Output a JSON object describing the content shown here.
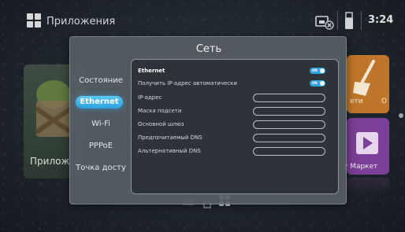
{
  "topbar": {
    "apps_title": "Приложения",
    "network_status_icon": "ethernet-disconnected-icon",
    "usb_icon": "usb-icon",
    "clock": "3:24"
  },
  "background": {
    "left_tile_label": "Прилож",
    "right_tile_1_label_a": "ети",
    "right_tile_1_label_b": "O",
    "right_tile_2_label": "у Маркет"
  },
  "dialog": {
    "title": "Сеть",
    "nav": [
      {
        "label": "Состояние",
        "active": false
      },
      {
        "label": "Ethernet",
        "active": true
      },
      {
        "label": "Wi-Fi",
        "active": false
      },
      {
        "label": "PPPoE",
        "active": false
      },
      {
        "label": "Точка досту",
        "active": false
      }
    ],
    "settings": {
      "ethernet": {
        "label": "Ethernet",
        "toggle": "ON",
        "enabled": true
      },
      "auto_ip": {
        "label": "Получить IP-адрес автоматически",
        "toggle": "ON",
        "enabled": true
      },
      "fields": [
        {
          "label": "IP-адрес",
          "value": ""
        },
        {
          "label": "Маска подсети",
          "value": ""
        },
        {
          "label": "Основной шлюз",
          "value": ""
        },
        {
          "label": "Предпочитаемый DNS",
          "value": ""
        },
        {
          "label": "Альтернативный DNS",
          "value": ""
        }
      ]
    }
  },
  "dock": {
    "items": [
      "tv-icon",
      "home-icon",
      "apps-icon"
    ]
  },
  "colors": {
    "accent": "#2aa1de",
    "dialog_bg": "#565e64",
    "panel_bg": "#2d3339",
    "tile_orange": "#c0762a",
    "tile_purple": "#7a3f96"
  }
}
